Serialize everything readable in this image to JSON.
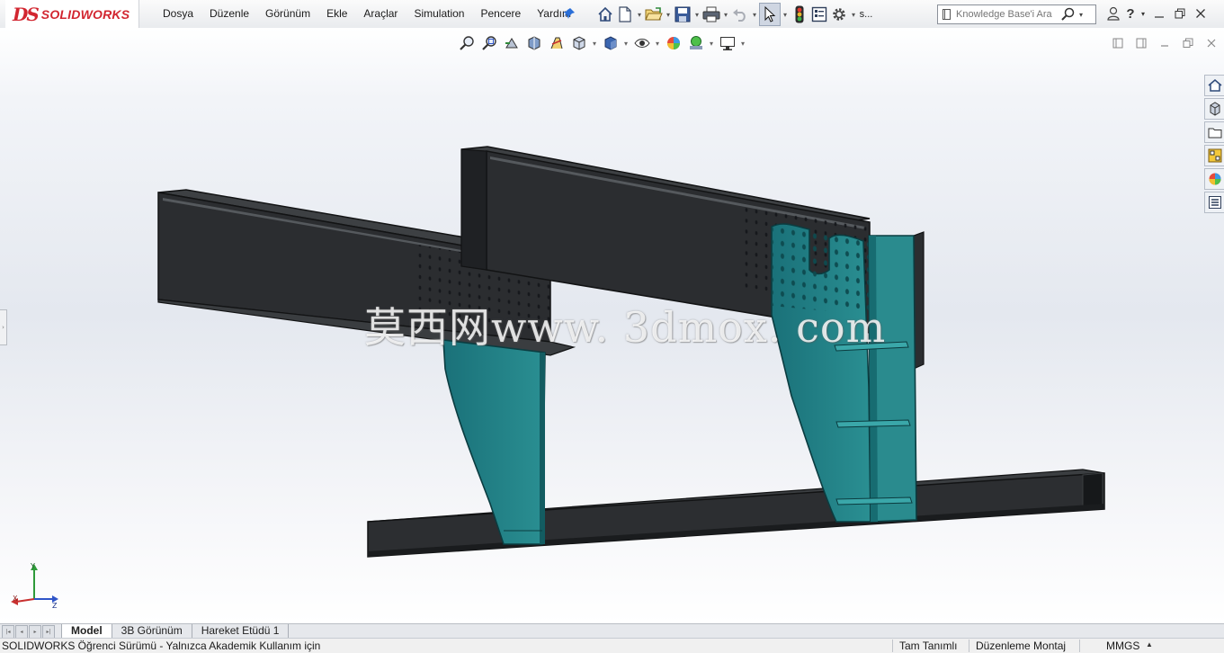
{
  "app": {
    "brand": "SOLIDWORKS",
    "brand_mark": "DS",
    "menu": [
      "Dosya",
      "Düzenle",
      "Görünüm",
      "Ekle",
      "Araçlar",
      "Simulation",
      "Pencere",
      "Yardım"
    ],
    "toolbar_overflow_label": "s...",
    "search_placeholder": "Knowledge Base'i Ara",
    "help_label": "?"
  },
  "toolbar_icons": [
    "home-icon",
    "new-document-icon",
    "open-folder-icon",
    "save-icon",
    "print-icon",
    "undo-icon",
    "select-pointer-icon",
    "traffic-light-icon",
    "file-properties-icon",
    "options-gear-icon",
    "user-icon",
    "help-icon"
  ],
  "view_toolbar_icons": [
    "zoom-to-fit-icon",
    "zoom-to-area-icon",
    "previous-view-icon",
    "section-view-icon",
    "dynamic-annotation-icon",
    "view-orientation-icon",
    "display-style-icon",
    "hide-show-icon",
    "edit-appearance-icon",
    "apply-scene-icon",
    "view-settings-icon"
  ],
  "task_pane_icons": [
    "solidworks-resources-icon",
    "design-library-icon",
    "file-explorer-icon",
    "view-palette-icon",
    "appearances-icon",
    "custom-properties-icon"
  ],
  "watermark": "莫西网www. 3dmox. com",
  "triad": {
    "y": "Y",
    "x": "X",
    "z": "Z"
  },
  "tabs": [
    "Model",
    "3B Görünüm",
    "Hareket Etüdü 1"
  ],
  "active_tab": "Model",
  "status": {
    "left": "SOLIDWORKS Öğrenci Sürümü - Yalnızca Akademik Kullanım için",
    "definition": "Tam Tanımlı",
    "editing": "Düzenleme Montaj",
    "units": "MMGS",
    "units_arrow": "▲"
  },
  "colors": {
    "beam": "#2b2d30",
    "beam_edge": "#121314",
    "bracket": "#1f7f86",
    "bracket_edge": "#0b3c40",
    "accent": "#d22630"
  }
}
